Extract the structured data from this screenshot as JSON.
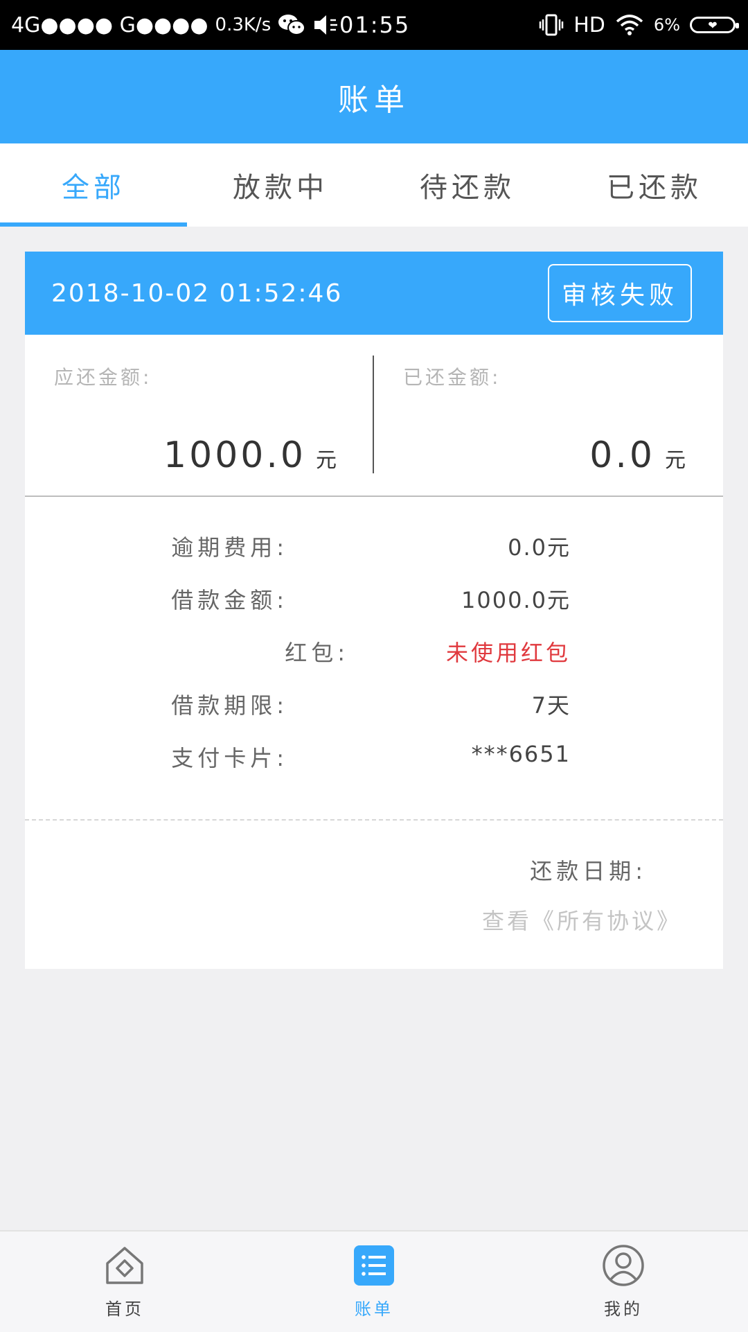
{
  "status_bar": {
    "network": "4G●●●● G●●●●",
    "speed": "0.3K/s",
    "time": "01:55",
    "hd": "HD",
    "battery": "6%"
  },
  "header": {
    "title": "账单"
  },
  "tabs": [
    {
      "label": "全部",
      "active": true
    },
    {
      "label": "放款中",
      "active": false
    },
    {
      "label": "待还款",
      "active": false
    },
    {
      "label": "已还款",
      "active": false
    }
  ],
  "bill": {
    "datetime": "2018-10-02 01:52:46",
    "status": "审核失败",
    "due_label": "应还金额:",
    "due_value": "1000.0",
    "due_unit": "元",
    "paid_label": "已还金额:",
    "paid_value": "0.0",
    "paid_unit": "元",
    "details": [
      {
        "key": "逾期费用:",
        "value": "0.0元"
      },
      {
        "key": "借款金额:",
        "value": "1000.0元"
      },
      {
        "key": "红包:",
        "value": "未使用红包"
      },
      {
        "key": "借款期限:",
        "value": "7天"
      },
      {
        "key": "支付卡片:",
        "value": "***6651"
      }
    ],
    "repay_date_label": "还款日期:",
    "agreement_link": "查看《所有协议》"
  },
  "bottom_nav": [
    {
      "label": "首页",
      "icon": "home-icon",
      "active": false
    },
    {
      "label": "账单",
      "icon": "list-icon",
      "active": true
    },
    {
      "label": "我的",
      "icon": "profile-icon",
      "active": false
    }
  ],
  "colors": {
    "accent": "#37a8fb",
    "warning": "#e0393e"
  }
}
